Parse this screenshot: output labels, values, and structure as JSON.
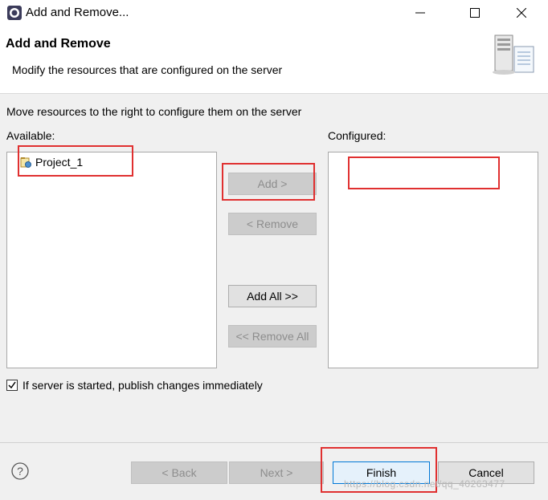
{
  "window": {
    "title": "Add and Remove..."
  },
  "header": {
    "title": "Add and Remove",
    "description": "Modify the resources that are configured on the server",
    "icon": "server-icon"
  },
  "main": {
    "instruction": "Move resources to the right to configure them on the server",
    "available_label": "Available:",
    "configured_label": "Configured:",
    "available_items": [
      {
        "label": "Project_1",
        "icon": "project-icon"
      }
    ],
    "configured_items": []
  },
  "buttons": {
    "add": "Add >",
    "remove": "< Remove",
    "add_all": "Add All >>",
    "remove_all": "<< Remove All"
  },
  "options": {
    "publish_label": "If server is started, publish changes immediately",
    "publish_checked": true
  },
  "footer": {
    "back": "< Back",
    "next": "Next >",
    "finish": "Finish",
    "cancel": "Cancel"
  },
  "watermark": "https://blog.csdn.net/qq_40263477",
  "colors": {
    "annotation_red": "#e03030",
    "finish_border": "#0078d7"
  }
}
